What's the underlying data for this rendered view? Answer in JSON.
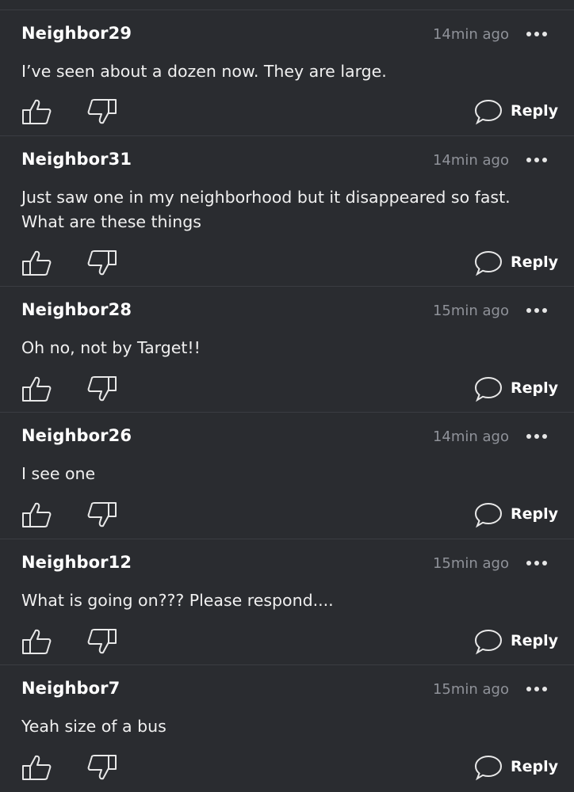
{
  "comments": [
    {
      "author": "Neighbor29",
      "time": "14min ago",
      "text": "I’ve seen about a dozen now.  They are large.",
      "reply_label": "Reply"
    },
    {
      "author": "Neighbor31",
      "time": "14min ago",
      "text": "Just saw one in my neighborhood but it disappeared so fast. What are these things",
      "reply_label": "Reply"
    },
    {
      "author": "Neighbor28",
      "time": "15min ago",
      "text": "Oh no, not by Target!!",
      "reply_label": "Reply"
    },
    {
      "author": "Neighbor26",
      "time": "14min ago",
      "text": "I see one",
      "reply_label": "Reply"
    },
    {
      "author": "Neighbor12",
      "time": "15min ago",
      "text": "What is going on??? Please respond....",
      "reply_label": "Reply"
    },
    {
      "author": "Neighbor7",
      "time": "15min ago",
      "text": "Yeah size of a bus",
      "reply_label": "Reply"
    }
  ],
  "icons": {
    "like": "thumbs-up-icon",
    "dislike": "thumbs-down-icon",
    "reply": "speech-bubble-icon",
    "more": "more-horizontal-icon"
  },
  "colors": {
    "background": "#2a2c30",
    "divider": "#3b3d42",
    "text": "#ffffff",
    "muted": "#8f9299"
  }
}
